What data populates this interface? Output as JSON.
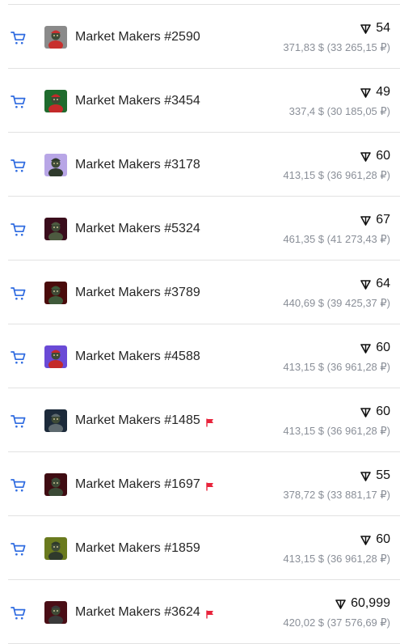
{
  "colors": {
    "accent": "#2f6be0",
    "flag": "#e8233b",
    "muted": "#8a8f98"
  },
  "icons": {
    "cart": "shopping-cart-icon",
    "ton": "ton-currency-icon",
    "flag": "red-flag-icon"
  },
  "items": [
    {
      "name": "Market Makers #2590",
      "price": "54",
      "fiat": "371,83 $ (33 265,15 ₽)",
      "flagged": false,
      "thumb_bg": "#8a8a8a",
      "thumb_fg": "#c8302e"
    },
    {
      "name": "Market Makers #3454",
      "price": "49",
      "fiat": "337,4 $ (30 185,05 ₽)",
      "flagged": false,
      "thumb_bg": "#1f6b2d",
      "thumb_fg": "#c42a2a"
    },
    {
      "name": "Market Makers #3178",
      "price": "60",
      "fiat": "413,15 $ (36 961,28 ₽)",
      "flagged": false,
      "thumb_bg": "#b8a6e6",
      "thumb_fg": "#2f3a2c"
    },
    {
      "name": "Market Makers #5324",
      "price": "67",
      "fiat": "461,35 $ (41 273,43 ₽)",
      "flagged": false,
      "thumb_bg": "#3a0d1c",
      "thumb_fg": "#4d5a40"
    },
    {
      "name": "Market Makers #3789",
      "price": "64",
      "fiat": "440,69 $ (39 425,37 ₽)",
      "flagged": false,
      "thumb_bg": "#4a0b0b",
      "thumb_fg": "#3f5a3a"
    },
    {
      "name": "Market Makers #4588",
      "price": "60",
      "fiat": "413,15 $ (36 961,28 ₽)",
      "flagged": false,
      "thumb_bg": "#6a4ad6",
      "thumb_fg": "#c42a2a"
    },
    {
      "name": "Market Makers #1485",
      "price": "60",
      "fiat": "413,15 $ (36 961,28 ₽)",
      "flagged": true,
      "thumb_bg": "#1c2a3a",
      "thumb_fg": "#5e6a6f"
    },
    {
      "name": "Market Makers #1697",
      "price": "55",
      "fiat": "378,72 $ (33 881,17 ₽)",
      "flagged": true,
      "thumb_bg": "#3f0c12",
      "thumb_fg": "#3b4a36"
    },
    {
      "name": "Market Makers #1859",
      "price": "60",
      "fiat": "413,15 $ (36 961,28 ₽)",
      "flagged": false,
      "thumb_bg": "#6a7a1e",
      "thumb_fg": "#2f3a2c"
    },
    {
      "name": "Market Makers #3624",
      "price": "60,999",
      "fiat": "420,02 $ (37 576,69 ₽)",
      "flagged": true,
      "thumb_bg": "#4a0e16",
      "thumb_fg": "#3a3a3a"
    }
  ]
}
